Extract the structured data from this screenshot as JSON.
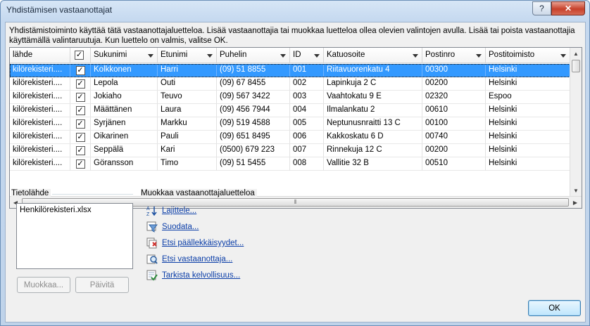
{
  "window": {
    "title": "Yhdistämisen vastaanottajat",
    "help_glyph": "?",
    "close_glyph": "✕"
  },
  "instructions": "Yhdistämistoiminto käyttää tätä vastaanottajaluetteloa. Lisää vastaanottajia tai muokkaa luetteloa ollea olevien valintojen avulla. Lisää tai poista vastaanottajia käyttämällä valintaruutuja. Kun luettelo on valmis, valitse OK.",
  "grid": {
    "headers": {
      "source": "lähde",
      "check": "✓",
      "last": "Sukunimi",
      "first": "Etunimi",
      "phone": "Puhelin",
      "id": "ID",
      "address": "Katuosoite",
      "zip": "Postinro",
      "city": "Postitoimisto"
    },
    "rows": [
      {
        "source": "kilörekisteri....",
        "checked": "✓",
        "last": "Kolkkonen",
        "first": "Harri",
        "phone": "(09) 51 8855",
        "id": "001",
        "address": "Riitavuorenkatu 4",
        "zip": "00300",
        "city": "Helsinki"
      },
      {
        "source": "kilörekisteri....",
        "checked": "✓",
        "last": "Lepola",
        "first": "Outi",
        "phone": "(09) 67 8455",
        "id": "002",
        "address": "Lapinkuja 2 C",
        "zip": "00200",
        "city": "Helsinki"
      },
      {
        "source": "kilörekisteri....",
        "checked": "✓",
        "last": "Jokiaho",
        "first": "Teuvo",
        "phone": "(09) 567 3422",
        "id": "003",
        "address": "Vaahtokatu 9 E",
        "zip": "02320",
        "city": "Espoo"
      },
      {
        "source": "kilörekisteri....",
        "checked": "✓",
        "last": "Määttänen",
        "first": "Laura",
        "phone": "(09) 456 7944",
        "id": "004",
        "address": "Ilmalankatu 2",
        "zip": "00610",
        "city": "Helsinki"
      },
      {
        "source": "kilörekisteri....",
        "checked": "✓",
        "last": "Syrjänen",
        "first": "Markku",
        "phone": "(09) 519 4588",
        "id": "005",
        "address": "Neptunusnraitti 13 C",
        "zip": "00100",
        "city": "Helsinki"
      },
      {
        "source": "kilörekisteri....",
        "checked": "✓",
        "last": "Oikarinen",
        "first": "Pauli",
        "phone": "(09) 651 8495",
        "id": "006",
        "address": "Kakkoskatu 6 D",
        "zip": "00740",
        "city": "Helsinki"
      },
      {
        "source": "kilörekisteri....",
        "checked": "✓",
        "last": "Seppälä",
        "first": "Kari",
        "phone": "(0500) 679 223",
        "id": "007",
        "address": "Rinnekuja 12 C",
        "zip": "00200",
        "city": "Helsinki"
      },
      {
        "source": "kilörekisteri....",
        "checked": "✓",
        "last": "Göransson",
        "first": "Timo",
        "phone": "(09) 51 5455",
        "id": "008",
        "address": "Vallitie 32 B",
        "zip": "00510",
        "city": "Helsinki"
      }
    ],
    "selected_row": 0
  },
  "source_group": {
    "label": "Tietolähde",
    "items": [
      "Henkilörekisteri.xlsx"
    ],
    "edit_button": "Muokkaa...",
    "refresh_button": "Päivitä"
  },
  "refine_group": {
    "label": "Muokkaa vastaanottajaluetteloa",
    "links": [
      {
        "label": "Lajittele...",
        "icon": "sort-icon"
      },
      {
        "label": "Suodata...",
        "icon": "filter-icon"
      },
      {
        "label": "Etsi päällekkäisyydet...",
        "icon": "duplicates-icon"
      },
      {
        "label": "Etsi vastaanottaja...",
        "icon": "find-recipient-icon"
      },
      {
        "label": "Tarkista kelvollisuus...",
        "icon": "validate-icon"
      }
    ]
  },
  "ok_button": "OK"
}
